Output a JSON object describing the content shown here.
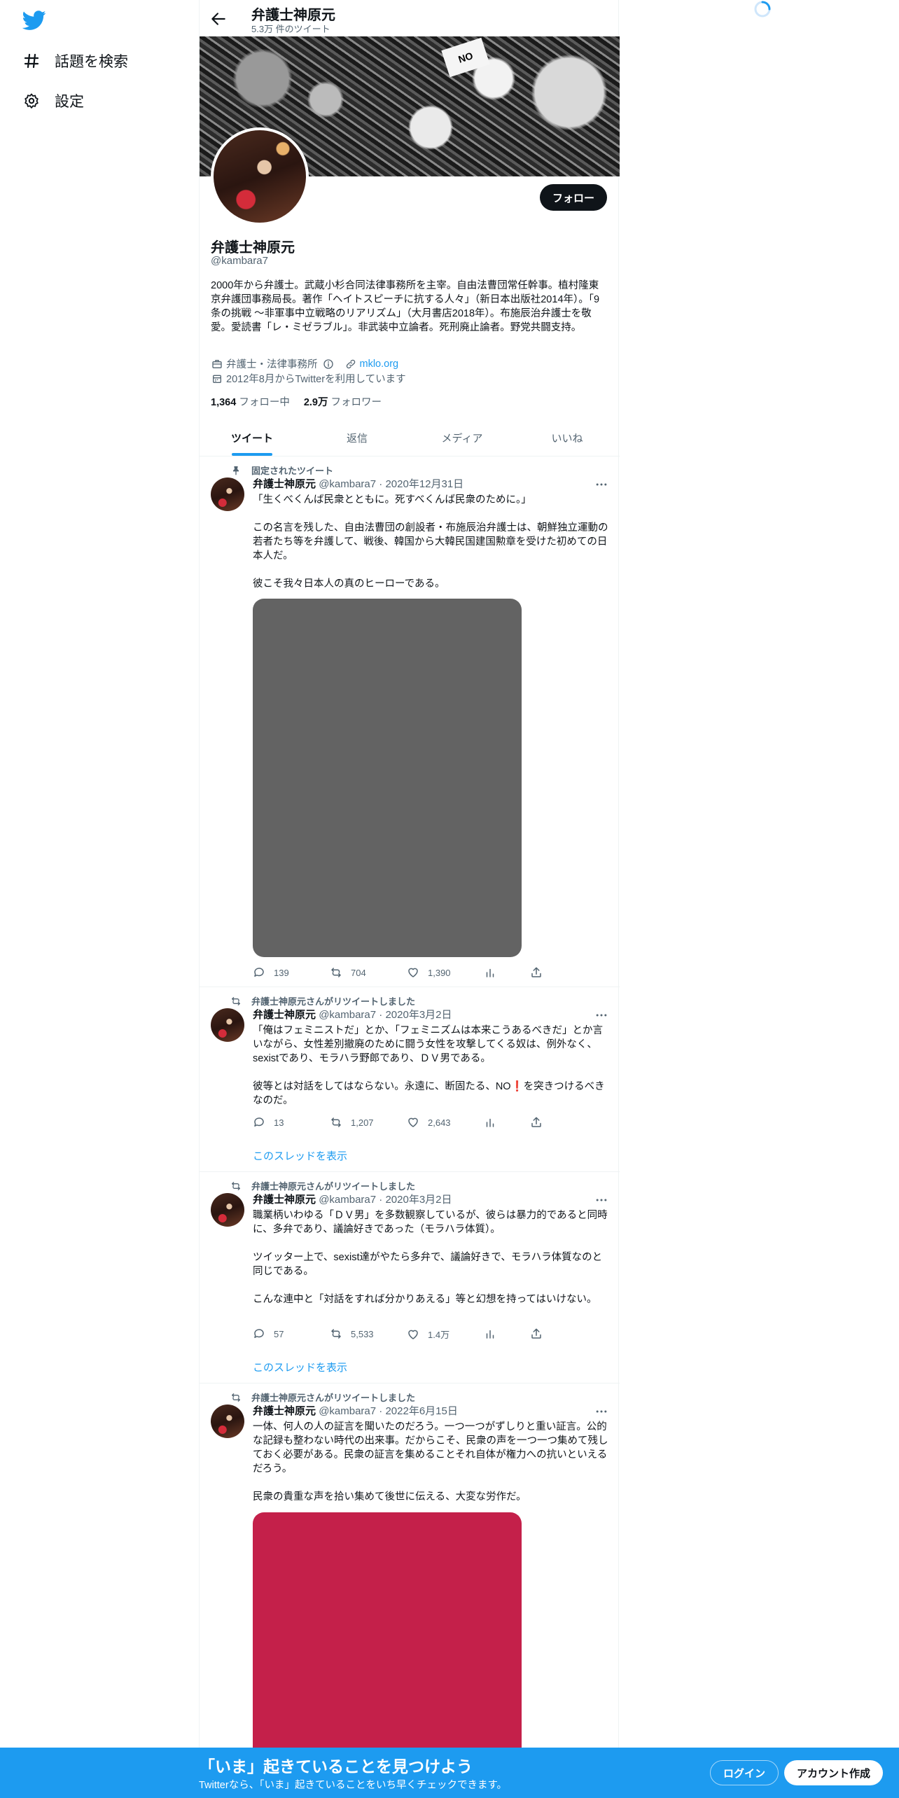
{
  "nav": {
    "explore_label": "話題を検索",
    "settings_label": "設定"
  },
  "header": {
    "name": "弁護士神原元",
    "tweet_count": "5.3万 件のツイート"
  },
  "banner": {
    "sign_text": "NO"
  },
  "profile": {
    "name": "弁護士神原元",
    "handle": "@kambara7",
    "follow_label": "フォロー",
    "bio": "2000年から弁護士。武蔵小杉合同法律事務所を主宰。自由法曹団常任幹事。植村隆東京弁護団事務局長。著作「ヘイトスピーチに抗する人々」（新日本出版社2014年）。「9条の挑戦 ～非軍事中立戦略のリアリズム」（大月書店2018年）。布施辰治弁護士を敬愛。愛読書「レ・ミゼラブル」。非武装中立論者。死刑廃止論者。野党共闘支持。",
    "category": "弁護士・法律事務所",
    "website": "mklo.org",
    "joined": "2012年8月からTwitterを利用しています",
    "following_count": "1,364",
    "following_label": "フォロー中",
    "followers_count": "2.9万",
    "followers_label": "フォロワー"
  },
  "tabs": [
    {
      "label": "ツイート",
      "active": true
    },
    {
      "label": "返信",
      "active": false
    },
    {
      "label": "メディア",
      "active": false
    },
    {
      "label": "いいね",
      "active": false
    }
  ],
  "tweets": [
    {
      "social": "固定されたツイート",
      "name": "弁護士神原元",
      "handle_date": "@kambara7 · 2020年12月31日",
      "text": "「生くべくんば民衆とともに。死すべくんば民衆のために。」\n\nこの名言を残した、自由法曹団の創設者・布施辰治弁護士は、朝鮮独立運動の若者たち等を弁護して、戦後、韓国から大韓民国建国勲章を受けた初めての日本人だ。\n\n彼こそ我々日本人の真のヒーローである。",
      "media_color": "#636363",
      "replies": "139",
      "retweets": "704",
      "likes": "1,390"
    },
    {
      "social": "弁護士神原元さんがリツイートしました",
      "name": "弁護士神原元",
      "handle_date": "@kambara7 · 2020年3月2日",
      "text": "「俺はフェミニストだ」とか、「フェミニズムは本来こうあるべきだ」とか言いながら、女性差別撤廃のために闘う女性を攻撃してくる奴は、例外なく、sexistであり、モラハラ野郎であり、ＤＶ男である。\n\n彼等とは対話をしてはならない。永遠に、断固たる、NO❗を突きつけるべきなのだ。",
      "replies": "13",
      "retweets": "1,207",
      "likes": "2,643",
      "thread_label": "このスレッドを表示"
    },
    {
      "social": "弁護士神原元さんがリツイートしました",
      "name": "弁護士神原元",
      "handle_date": "@kambara7 · 2020年3月2日",
      "text": "職業柄いわゆる「ＤＶ男」を多数観察しているが、彼らは暴力的であると同時に、多弁であり、議論好きであった（モラハラ体質）。\n\nツイッター上で、sexist達がやたら多弁で、議論好きで、モラハラ体質なのと同じである。\n\nこんな連中と「対話をすれば分かりあえる」等と幻想を持ってはいけない。",
      "replies": "57",
      "retweets": "5,533",
      "likes": "1.4万",
      "thread_label": "このスレッドを表示"
    },
    {
      "social": "弁護士神原元さんがリツイートしました",
      "name": "弁護士神原元",
      "handle_date": "@kambara7 · 2022年6月15日",
      "text": "一体、何人の人の証言を聞いたのだろう。一つ一つがずしりと重い証言。公的な記録も整わない時代の出来事。だからこそ、民衆の声を一つ一つ集めて残しておく必要がある。民衆の証言を集めることそれ自体が権力への抗いといえるだろう。\n\n民衆の貴重な声を拾い集めて後世に伝える、大変な労作だ。",
      "media_color": "#c4204a"
    }
  ],
  "bottom": {
    "title": "「いま」起きていることを見つけよう",
    "subtitle": "Twitterなら、「いま」起きていることをいち早くチェックできます。",
    "login_label": "ログイン",
    "signup_label": "アカウント作成"
  },
  "colors": {
    "accent": "#1d9bf0",
    "text": "#0f1419",
    "muted": "#536471"
  }
}
